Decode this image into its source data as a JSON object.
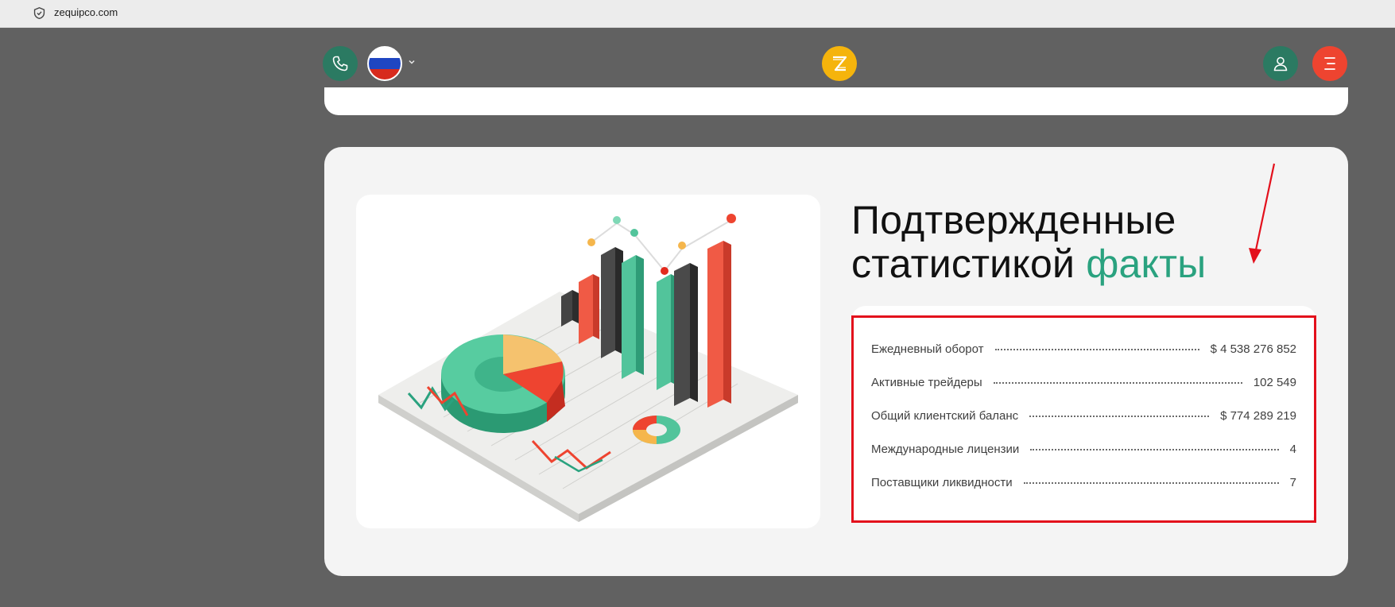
{
  "browser": {
    "url": "zequipco.com"
  },
  "header": {
    "phone_icon": "phone-icon",
    "language_flag": "russia-flag",
    "logo_letter": "Z",
    "user_icon": "user-icon",
    "menu_icon": "menu-icon"
  },
  "facts": {
    "title_part1": "Подтвержденные",
    "title_part2": "статистикой",
    "title_accent": "факты",
    "stats": [
      {
        "label": "Ежедневный оборот",
        "value": "$ 4 538 276 852"
      },
      {
        "label": "Активные трейдеры",
        "value": "102 549"
      },
      {
        "label": "Общий клиентский баланс",
        "value": "$ 774 289 219"
      },
      {
        "label": "Международные лицензии",
        "value": "4"
      },
      {
        "label": "Поставщики ликвидности",
        "value": "7"
      }
    ]
  },
  "colors": {
    "accent_green": "#2aa27f",
    "brand_yellow": "#f5b40c",
    "menu_red": "#ee4430",
    "highlight_red": "#e3101c"
  }
}
